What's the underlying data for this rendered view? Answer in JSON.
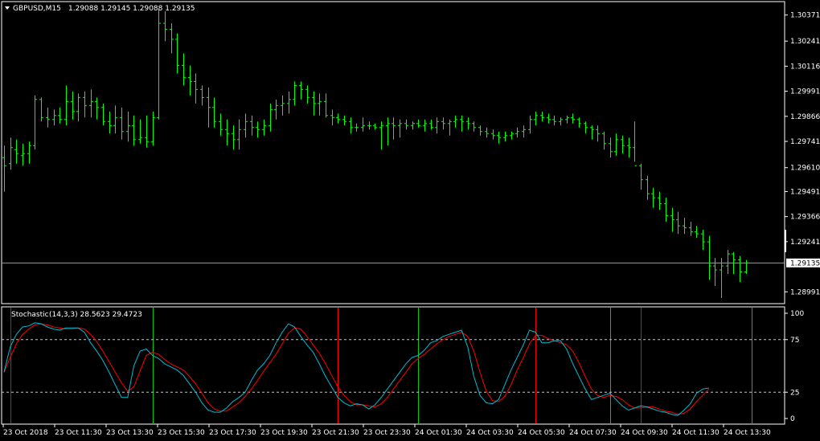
{
  "header": {
    "symbol": "GBPUSD,M15",
    "ohlc": "1.29088 1.29145 1.29088 1.29135"
  },
  "indicator": {
    "label": "Stochastic",
    "params": "(14,3,3) 28.5623 29.4723"
  },
  "current_price_label": "1.29135",
  "colors": {
    "background": "#000000",
    "frame": "#ffffff",
    "bar": "#00ff00",
    "main_line": "#00bcd4",
    "signal_line": "#ff0000",
    "level_line": "#c8c8c8",
    "bid_line": "#8fa3b8",
    "marker_green": "#00cc00",
    "marker_red": "#ff0000"
  },
  "chart_data": [
    {
      "type": "ohlc",
      "name": "GBPUSD,M15",
      "y_ticks": [
        1.30371,
        1.30241,
        1.30116,
        1.29991,
        1.29866,
        1.29741,
        1.2961,
        1.29491,
        1.29366,
        1.29241,
        1.28991
      ],
      "ylim": [
        1.2894,
        1.3043
      ],
      "current_price": 1.29135,
      "bars": [
        [
          1.2966,
          1.2972,
          1.2949,
          1.2962
        ],
        [
          1.2963,
          1.2976,
          1.296,
          1.2971
        ],
        [
          1.297,
          1.2975,
          1.2963,
          1.2968
        ],
        [
          1.2967,
          1.2973,
          1.2962,
          1.2968
        ],
        [
          1.2968,
          1.2974,
          1.2963,
          1.2972
        ],
        [
          1.2972,
          1.2997,
          1.297,
          1.2995
        ],
        [
          1.2995,
          1.2996,
          1.2984,
          1.2986
        ],
        [
          1.2986,
          1.2991,
          1.2981,
          1.2985
        ],
        [
          1.2985,
          1.299,
          1.2982,
          1.2987
        ],
        [
          1.2987,
          1.2991,
          1.2983,
          1.2985
        ],
        [
          1.2985,
          1.3002,
          1.2982,
          1.2994
        ],
        [
          1.2994,
          1.2999,
          1.2985,
          1.2989
        ],
        [
          1.2989,
          1.2998,
          1.2984,
          1.2996
        ],
        [
          1.2996,
          1.2999,
          1.2986,
          1.2992
        ],
        [
          1.2992,
          1.3,
          1.2986,
          1.2994
        ],
        [
          1.2994,
          1.2996,
          1.2985,
          1.2991
        ],
        [
          1.2991,
          1.2993,
          1.2982,
          1.2984
        ],
        [
          1.2984,
          1.2989,
          1.2978,
          1.2982
        ],
        [
          1.2982,
          1.2992,
          1.2978,
          1.2986
        ],
        [
          1.2986,
          1.2991,
          1.2975,
          1.2979
        ],
        [
          1.2979,
          1.2989,
          1.2974,
          1.2982
        ],
        [
          1.2982,
          1.2987,
          1.2972,
          1.2975
        ],
        [
          1.2975,
          1.2985,
          1.2973,
          1.2976
        ],
        [
          1.2976,
          1.2987,
          1.2971,
          1.2974
        ],
        [
          1.2974,
          1.2989,
          1.2972,
          1.2986
        ],
        [
          1.2986,
          1.304,
          1.2985,
          1.3033
        ],
        [
          1.3033,
          1.3039,
          1.3024,
          1.303
        ],
        [
          1.303,
          1.3033,
          1.3018,
          1.3025
        ],
        [
          1.3025,
          1.3028,
          1.3008,
          1.3012
        ],
        [
          1.3012,
          1.3018,
          1.3002,
          1.3006
        ],
        [
          1.3006,
          1.3012,
          1.2997,
          1.3004
        ],
        [
          1.3004,
          1.3008,
          1.2993,
          1.3
        ],
        [
          1.3,
          1.3002,
          1.2992,
          1.2996
        ],
        [
          1.2996,
          1.3001,
          1.2981,
          1.2991
        ],
        [
          1.2991,
          1.2996,
          1.2981,
          1.2984
        ],
        [
          1.2984,
          1.2988,
          1.2977,
          1.298
        ],
        [
          1.298,
          1.2985,
          1.2972,
          1.2978
        ],
        [
          1.2978,
          1.2982,
          1.297,
          1.2975
        ],
        [
          1.2975,
          1.2985,
          1.297,
          1.298
        ],
        [
          1.298,
          1.2988,
          1.2976,
          1.2984
        ],
        [
          1.2984,
          1.2987,
          1.2977,
          1.2981
        ],
        [
          1.2981,
          1.2984,
          1.2976,
          1.298
        ],
        [
          1.298,
          1.2985,
          1.2977,
          1.2982
        ],
        [
          1.2982,
          1.2993,
          1.2979,
          1.299
        ],
        [
          1.299,
          1.2995,
          1.2985,
          1.2992
        ],
        [
          1.2992,
          1.2997,
          1.2987,
          1.2993
        ],
        [
          1.2993,
          1.2999,
          1.2988,
          1.2995
        ],
        [
          1.2995,
          1.3004,
          1.2992,
          1.3002
        ],
        [
          1.3002,
          1.3004,
          1.2995,
          1.3
        ],
        [
          1.3,
          1.3002,
          1.2993,
          1.2996
        ],
        [
          1.2996,
          1.2999,
          1.2987,
          1.2993
        ],
        [
          1.2993,
          1.2998,
          1.2987,
          1.2994
        ],
        [
          1.2994,
          1.2998,
          1.2986,
          1.2987
        ],
        [
          1.2987,
          1.299,
          1.2982,
          1.2986
        ],
        [
          1.2986,
          1.2988,
          1.2983,
          1.2985
        ],
        [
          1.2985,
          1.2987,
          1.2982,
          1.2984
        ],
        [
          1.2984,
          1.2986,
          1.2978,
          1.2981
        ],
        [
          1.2981,
          1.2983,
          1.2979,
          1.2981
        ],
        [
          1.2981,
          1.2986,
          1.2979,
          1.2982
        ],
        [
          1.2982,
          1.2984,
          1.298,
          1.2982
        ],
        [
          1.2982,
          1.2983,
          1.298,
          1.2981
        ],
        [
          1.2981,
          1.2984,
          1.297,
          1.2982
        ],
        [
          1.2982,
          1.2986,
          1.2972,
          1.2983
        ],
        [
          1.2983,
          1.2986,
          1.2975,
          1.2982
        ],
        [
          1.2982,
          1.2985,
          1.2976,
          1.2983
        ],
        [
          1.2983,
          1.2985,
          1.298,
          1.2982
        ],
        [
          1.2982,
          1.2984,
          1.298,
          1.2983
        ],
        [
          1.2983,
          1.2985,
          1.2981,
          1.2982
        ],
        [
          1.2982,
          1.2985,
          1.2979,
          1.2983
        ],
        [
          1.2983,
          1.2985,
          1.298,
          1.2981
        ],
        [
          1.2981,
          1.2986,
          1.2978,
          1.2984
        ],
        [
          1.2984,
          1.2986,
          1.298,
          1.2983
        ],
        [
          1.2983,
          1.2985,
          1.2977,
          1.2984
        ],
        [
          1.2984,
          1.2987,
          1.2981,
          1.2985
        ],
        [
          1.2985,
          1.2987,
          1.2979,
          1.2984
        ],
        [
          1.2984,
          1.2986,
          1.298,
          1.2983
        ],
        [
          1.2983,
          1.2984,
          1.2979,
          1.2981
        ],
        [
          1.2981,
          1.2982,
          1.2977,
          1.2979
        ],
        [
          1.2979,
          1.2981,
          1.2976,
          1.2978
        ],
        [
          1.2978,
          1.298,
          1.2975,
          1.2977
        ],
        [
          1.2977,
          1.2979,
          1.2973,
          1.2976
        ],
        [
          1.2976,
          1.2979,
          1.2974,
          1.2977
        ],
        [
          1.2977,
          1.2979,
          1.2975,
          1.2978
        ],
        [
          1.2978,
          1.2981,
          1.2976,
          1.2979
        ],
        [
          1.2979,
          1.2982,
          1.2976,
          1.298
        ],
        [
          1.298,
          1.2987,
          1.2978,
          1.2985
        ],
        [
          1.2985,
          1.2989,
          1.2982,
          1.2987
        ],
        [
          1.2987,
          1.2989,
          1.2984,
          1.2986
        ],
        [
          1.2986,
          1.2988,
          1.2983,
          1.2985
        ],
        [
          1.2985,
          1.2987,
          1.2982,
          1.2984
        ],
        [
          1.2984,
          1.2986,
          1.2982,
          1.2985
        ],
        [
          1.2985,
          1.2987,
          1.2983,
          1.2986
        ],
        [
          1.2986,
          1.2988,
          1.2983,
          1.2985
        ],
        [
          1.2985,
          1.2986,
          1.2981,
          1.2983
        ],
        [
          1.2983,
          1.2984,
          1.2978,
          1.2981
        ],
        [
          1.2981,
          1.2982,
          1.2975,
          1.298
        ],
        [
          1.298,
          1.2982,
          1.2974,
          1.2978
        ],
        [
          1.2978,
          1.2979,
          1.297,
          1.2973
        ],
        [
          1.2973,
          1.2976,
          1.2966,
          1.2969
        ],
        [
          1.2969,
          1.2978,
          1.2967,
          1.2975
        ],
        [
          1.2975,
          1.2977,
          1.2968,
          1.2972
        ],
        [
          1.2972,
          1.2976,
          1.2966,
          1.2971
        ],
        [
          1.2971,
          1.2984,
          1.2964,
          1.2962
        ],
        [
          1.2962,
          1.2963,
          1.295,
          1.2955
        ],
        [
          1.2955,
          1.2957,
          1.2945,
          1.2948
        ],
        [
          1.2948,
          1.2951,
          1.2941,
          1.2946
        ],
        [
          1.2946,
          1.2949,
          1.294,
          1.2943
        ],
        [
          1.2943,
          1.2946,
          1.2934,
          1.2937
        ],
        [
          1.2937,
          1.2941,
          1.2929,
          1.2935
        ],
        [
          1.2935,
          1.2939,
          1.2928,
          1.2932
        ],
        [
          1.2932,
          1.2936,
          1.2928,
          1.2931
        ],
        [
          1.2931,
          1.2934,
          1.2927,
          1.2929
        ],
        [
          1.2929,
          1.2932,
          1.2926,
          1.2928
        ],
        [
          1.2928,
          1.293,
          1.292,
          1.2924
        ],
        [
          1.2924,
          1.2927,
          1.2905,
          1.2912
        ],
        [
          1.2912,
          1.2916,
          1.2902,
          1.291
        ],
        [
          1.291,
          1.2916,
          1.2896,
          1.2912
        ],
        [
          1.2912,
          1.292,
          1.2908,
          1.2918
        ],
        [
          1.2918,
          1.2919,
          1.2908,
          1.2915
        ],
        [
          1.2915,
          1.2917,
          1.2904,
          1.2909
        ],
        [
          1.2909,
          1.2915,
          1.2908,
          1.29135
        ]
      ]
    },
    {
      "type": "line",
      "name": "Stochastic",
      "y_ticks": [
        100,
        75,
        25,
        0
      ],
      "ylim": [
        0,
        100
      ],
      "levels": [
        75,
        25
      ],
      "series": [
        {
          "name": "main",
          "values": [
            44,
            68,
            80,
            87,
            88,
            91,
            90,
            87,
            85,
            84,
            86,
            86,
            86,
            82,
            72,
            64,
            55,
            44,
            32,
            20,
            20,
            50,
            64,
            66,
            60,
            57,
            52,
            49,
            46,
            41,
            33,
            25,
            15,
            8,
            6,
            6,
            10,
            16,
            20,
            25,
            36,
            46,
            52,
            60,
            72,
            82,
            90,
            87,
            78,
            70,
            63,
            52,
            40,
            30,
            20,
            15,
            12,
            14,
            13,
            9,
            13,
            20,
            28,
            36,
            44,
            52,
            58,
            60,
            65,
            72,
            74,
            78,
            80,
            82,
            84,
            68,
            40,
            22,
            15,
            14,
            18,
            32,
            46,
            58,
            70,
            84,
            82,
            72,
            72,
            74,
            74,
            66,
            52,
            40,
            28,
            18,
            20,
            22,
            24,
            18,
            12,
            8,
            10,
            12,
            11,
            9,
            7,
            6,
            4,
            3,
            8,
            14,
            24,
            28,
            29
          ]
        },
        {
          "name": "signal",
          "values": [
            44,
            58,
            71,
            80,
            85,
            89,
            90,
            89,
            87,
            86,
            85,
            85,
            86,
            85,
            80,
            73,
            64,
            54,
            44,
            34,
            26,
            30,
            45,
            60,
            63,
            61,
            56,
            52,
            49,
            46,
            40,
            33,
            24,
            15,
            9,
            7,
            7,
            11,
            15,
            21,
            28,
            36,
            45,
            53,
            61,
            71,
            81,
            86,
            85,
            78,
            70,
            62,
            52,
            41,
            30,
            22,
            16,
            13,
            13,
            12,
            11,
            14,
            20,
            28,
            36,
            44,
            52,
            57,
            61,
            66,
            71,
            75,
            78,
            80,
            82,
            78,
            64,
            44,
            26,
            17,
            16,
            21,
            32,
            46,
            58,
            71,
            79,
            79,
            76,
            74,
            72,
            70,
            64,
            53,
            40,
            28,
            22,
            20,
            22,
            21,
            18,
            13,
            10,
            10,
            11,
            11,
            9,
            7,
            6,
            4,
            5,
            9,
            16,
            22,
            28
          ]
        }
      ]
    }
  ],
  "x_axis": {
    "labels": [
      "23 Oct 2018",
      "23 Oct 11:30",
      "23 Oct 13:30",
      "23 Oct 15:30",
      "23 Oct 17:30",
      "23 Oct 19:30",
      "23 Oct 21:30",
      "23 Oct 23:30",
      "24 Oct 01:30",
      "24 Oct 03:30",
      "24 Oct 05:30",
      "24 Oct 07:30",
      "24 Oct 09:30",
      "24 Oct 11:30",
      "24 Oct 13:30"
    ]
  },
  "markers": [
    {
      "color": "red",
      "bar": 1
    },
    {
      "color": "green",
      "bar": 24
    },
    {
      "color": "red",
      "bar": 54
    },
    {
      "color": "green",
      "bar": 67
    },
    {
      "color": "red",
      "bar": 86
    },
    {
      "color": "green",
      "bar": 98
    },
    {
      "color": "red",
      "bar": 103
    },
    {
      "color": "green",
      "bar": 121
    }
  ]
}
